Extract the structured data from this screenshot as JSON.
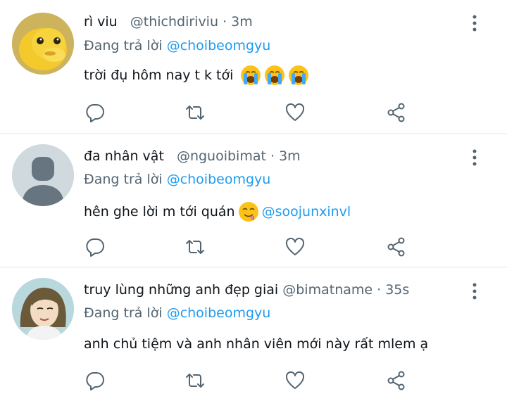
{
  "tweets": [
    {
      "display_name": "rì viu",
      "handle": "@thichdiriviu",
      "separator": "·",
      "time": "3m",
      "reply_prefix": "Đang trả lời",
      "reply_to": "@choibeomgyu",
      "text": "trời đụ hôm nay t k tới",
      "avatar": "yellow-creature-avatar",
      "emojis": [
        "loudly-crying-face",
        "loudly-crying-face",
        "loudly-crying-face"
      ]
    },
    {
      "display_name": "đa nhân vật",
      "handle": "@nguoibimat",
      "separator": "·",
      "time": "3m",
      "reply_prefix": "Đang trả lời",
      "reply_to": "@choibeomgyu",
      "text": "hên ghe lời m tới quán",
      "avatar": "default-person-avatar",
      "emojis": [
        "drooling-face"
      ],
      "mention": "@soojunxinvl"
    },
    {
      "display_name": "truy lùng những anh đẹp giai",
      "handle": "@bimatname",
      "separator": "·",
      "time": "35s",
      "reply_prefix": "Đang trả lời",
      "reply_to": "@choibeomgyu",
      "text": "anh chủ tiệm và anh nhân viên mới này rất mlem ạ",
      "avatar": "illustrated-girl-avatar",
      "emojis": []
    }
  ],
  "icons": {
    "more": "more-vertical-icon",
    "reply": "comment-icon",
    "retweet": "retweet-icon",
    "like": "heart-icon",
    "share": "share-icon"
  },
  "colors": {
    "icon": "#536471",
    "link": "#1d9bf0",
    "divider": "#eff3f4"
  }
}
